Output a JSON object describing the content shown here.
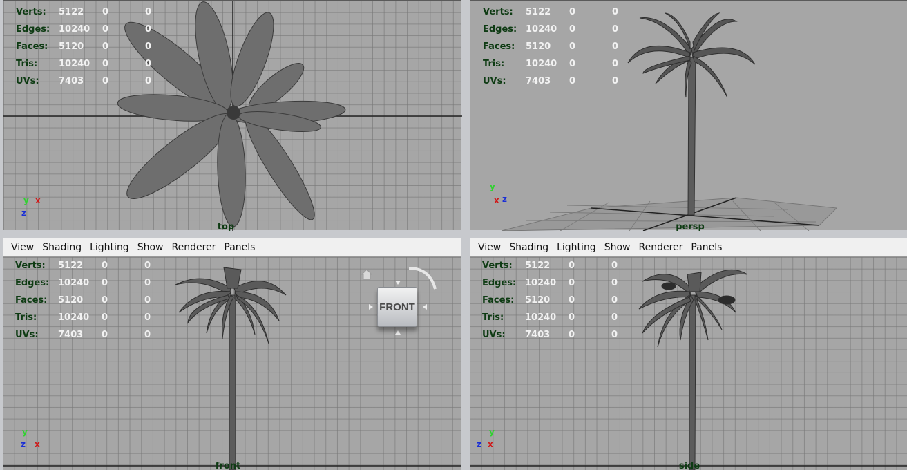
{
  "hud": {
    "rows": [
      {
        "label": "Verts:",
        "v1": "5122",
        "v2": "0",
        "v3": "0"
      },
      {
        "label": "Edges:",
        "v1": "10240",
        "v2": "0",
        "v3": "0"
      },
      {
        "label": "Faces:",
        "v1": "5120",
        "v2": "0",
        "v3": "0"
      },
      {
        "label": "Tris:",
        "v1": "10240",
        "v2": "0",
        "v3": "0"
      },
      {
        "label": "UVs:",
        "v1": "7403",
        "v2": "0",
        "v3": "0"
      }
    ]
  },
  "menu": [
    "View",
    "Shading",
    "Lighting",
    "Show",
    "Renderer",
    "Panels"
  ],
  "panes": {
    "top": {
      "camera": "top"
    },
    "persp": {
      "camera": "persp"
    },
    "front": {
      "camera": "front"
    },
    "side": {
      "camera": "side"
    }
  },
  "axes": {
    "x": "x",
    "y": "y",
    "z": "z"
  },
  "viewcube": {
    "face": "FRONT"
  },
  "colors": {
    "viewport_bg": "#a6a6a6",
    "hud_label": "#0e3b13",
    "hud_value": "#f2f2f2",
    "axis_x": "#d01818",
    "axis_y": "#2fd22f",
    "axis_z": "#1a2fd6"
  }
}
